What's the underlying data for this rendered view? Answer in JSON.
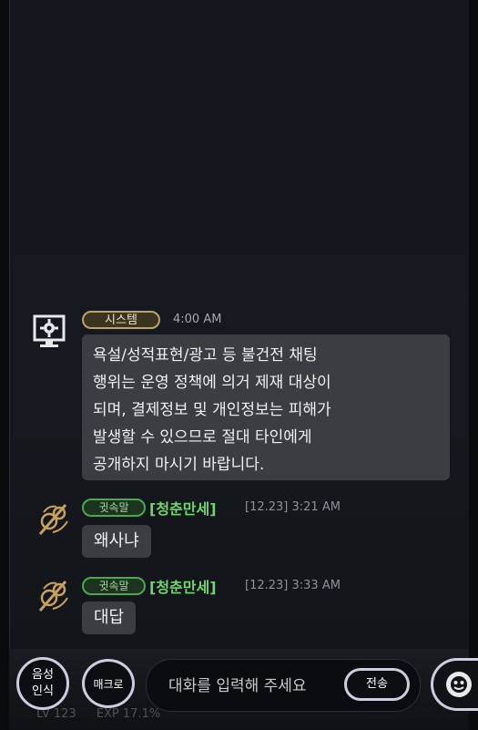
{
  "system_message": {
    "tag": "시스템",
    "time": "4:00 AM",
    "lines": [
      "욕설/성적표현/광고 등 불건전 채팅",
      "행위는 운영 정책에 의거 제재 대상이",
      "되며, 결제정보 및 개인정보는 피해가",
      "발생할 수 있으므로 절대 타인에게",
      "공개하지 마시기 바랍니다."
    ]
  },
  "messages": [
    {
      "tag": "귓속말",
      "sender": "[청춘만세]",
      "time": "[12.23] 3:21 AM",
      "text": "왜사냐"
    },
    {
      "tag": "귓속말",
      "sender": "[청춘만세]",
      "time": "[12.23] 3:33 AM",
      "text": "대답"
    }
  ],
  "bottom_bar": {
    "voice_label_1": "음성",
    "voice_label_2": "인식",
    "macro_label": "매크로",
    "input_placeholder": "대화를 입력해 주세요",
    "send_label": "전송",
    "level_text": "LV 123",
    "exp_text": "EXP 17.1%"
  },
  "colors": {
    "system_tag_border": "#b9a56a",
    "whisper_tag_border": "#4aa84e",
    "whisper_name": "#72d46f"
  }
}
